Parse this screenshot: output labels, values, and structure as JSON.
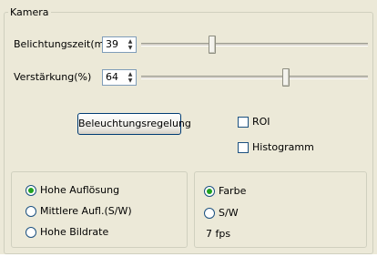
{
  "kamera": {
    "title": "Kamera",
    "exposure": {
      "label": "Belichtungszeit(ms)",
      "value": "39"
    },
    "gain": {
      "label": "Verstärkung(%)",
      "value": "64"
    },
    "lighting_button": "Beleuchtungsregelung",
    "roi_label": "ROI",
    "roi_checked": false,
    "histogram_label": "Histogramm",
    "histogram_checked": false,
    "resolution_options": [
      {
        "label": "Hohe Auflösung",
        "selected": true
      },
      {
        "label": "Mittlere Aufl.(S/W)",
        "selected": false
      },
      {
        "label": "Hohe Bildrate",
        "selected": false
      }
    ],
    "color_options": [
      {
        "label": "Farbe",
        "selected": true
      },
      {
        "label": "S/W",
        "selected": false
      }
    ],
    "fps": "7 fps",
    "icons": {
      "spin_up": "arrow-up-icon",
      "spin_down": "arrow-down-icon"
    }
  }
}
